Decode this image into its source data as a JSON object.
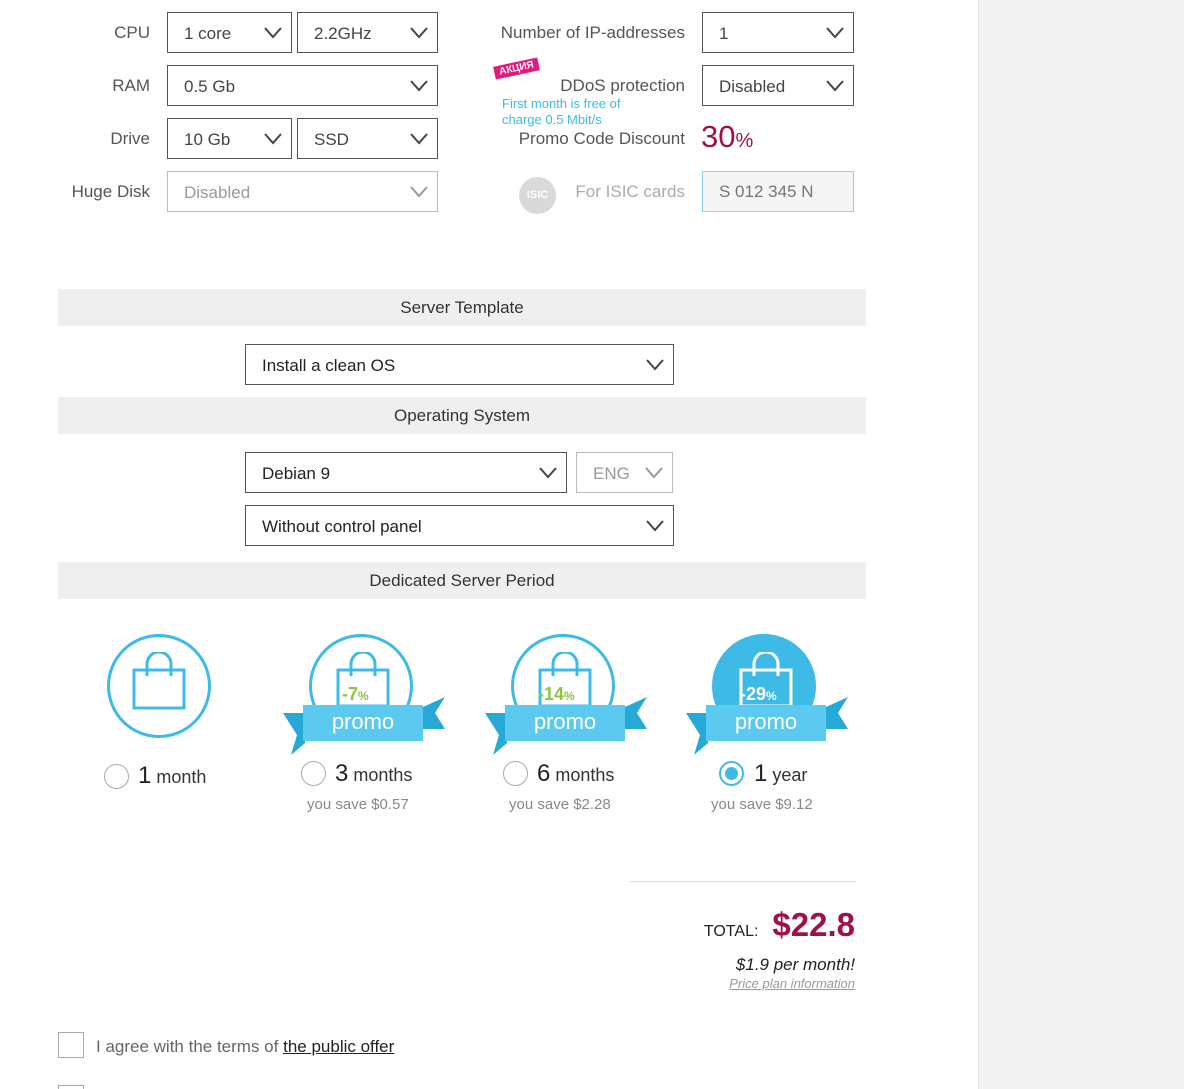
{
  "config": {
    "cpu": {
      "label": "CPU",
      "cores": "1 core",
      "freq": "2.2GHz"
    },
    "ram": {
      "label": "RAM",
      "value": "0.5 Gb"
    },
    "drive": {
      "label": "Drive",
      "size": "10 Gb",
      "type": "SSD"
    },
    "huge_disk": {
      "label": "Huge Disk",
      "value": "Disabled"
    },
    "ip": {
      "label": "Number of IP-addresses",
      "value": "1"
    },
    "ddos": {
      "badge": "АКЦИЯ",
      "label": "DDoS protection",
      "value": "Disabled",
      "note_line1": "First month is free of",
      "note_line2": "charge 0.5 Mbit/s"
    },
    "promo": {
      "label": "Promo Code Discount",
      "value": "30",
      "unit": "%"
    },
    "isic": {
      "icon_text": "ISIC",
      "label": "For ISIC cards",
      "placeholder": "S 012 345 N"
    }
  },
  "template": {
    "title": "Server Template",
    "value": "Install a clean OS"
  },
  "os": {
    "title": "Operating System",
    "value": "Debian 9",
    "lang": "ENG",
    "panel": "Without control panel"
  },
  "period": {
    "title": "Dedicated Server Period",
    "promo_label": "promo",
    "options": [
      {
        "num": "1",
        "unit": "month",
        "discount": "",
        "save": "",
        "selected": false
      },
      {
        "num": "3",
        "unit": "months",
        "discount": "-7",
        "save": "you save $0.57",
        "selected": false
      },
      {
        "num": "6",
        "unit": "months",
        "discount": "-14",
        "save": "you save $2.28",
        "selected": false
      },
      {
        "num": "1",
        "unit": "year",
        "discount": "-29",
        "save": "you save $9.12",
        "selected": true
      }
    ],
    "pct_sign": "%"
  },
  "total": {
    "label": "TOTAL:",
    "value": "$22.8",
    "per_month": "$1.9 per month!",
    "plan_link": "Price plan information"
  },
  "agree": {
    "text": "I agree with the terms of ",
    "link": "the public offer"
  },
  "colors": {
    "accent": "#3dbbe6",
    "price": "#a0104a",
    "promo_green": "#8cc63f"
  }
}
